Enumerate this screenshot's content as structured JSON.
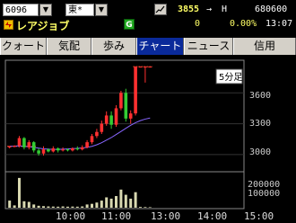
{
  "header": {
    "code": "6096",
    "market": "東*",
    "company": "レアジョブ",
    "price": "3855",
    "arrow": "→",
    "high_flag": "H",
    "volume": "680600",
    "change": "0",
    "change_pct": "0.00%",
    "time": "13:07",
    "g_badge": "G",
    "colors": {
      "price": "#ffff66",
      "change": "#ffff66",
      "time": "#ffffff",
      "badge": "#22aa22"
    }
  },
  "tabs": [
    {
      "label": "クォート"
    },
    {
      "label": "気配"
    },
    {
      "label": "歩み"
    },
    {
      "label": "チャート"
    },
    {
      "label": "ニュース"
    },
    {
      "label": "信用"
    }
  ],
  "chart": {
    "period_label": "5分足",
    "y_ticks": [
      "3600",
      "3300",
      "3000"
    ],
    "vol_ticks": [
      "200000",
      "100000"
    ],
    "x_ticks": [
      "10:00",
      "11:00",
      "13:00",
      "14:00",
      "15:00"
    ]
  },
  "chart_data": {
    "type": "candlestick",
    "interval": "5min",
    "ylim": [
      2850,
      3900
    ],
    "prev_close": 3080,
    "limit_high": 3855,
    "candles": [
      {
        "o": 3070,
        "h": 3085,
        "l": 3060,
        "c": 3080
      },
      {
        "o": 3080,
        "h": 3090,
        "l": 3070,
        "c": 3085
      },
      {
        "o": 3085,
        "h": 3180,
        "l": 3070,
        "c": 3160
      },
      {
        "o": 3160,
        "h": 3170,
        "l": 3050,
        "c": 3070
      },
      {
        "o": 3070,
        "h": 3140,
        "l": 3050,
        "c": 3120
      },
      {
        "o": 3120,
        "h": 3130,
        "l": 3020,
        "c": 3040
      },
      {
        "o": 3040,
        "h": 3060,
        "l": 2990,
        "c": 3010
      },
      {
        "o": 3010,
        "h": 3080,
        "l": 2990,
        "c": 3050
      },
      {
        "o": 3050,
        "h": 3060,
        "l": 3020,
        "c": 3030
      },
      {
        "o": 3030,
        "h": 3080,
        "l": 3020,
        "c": 3060
      },
      {
        "o": 3060,
        "h": 3070,
        "l": 3020,
        "c": 3040
      },
      {
        "o": 3040,
        "h": 3070,
        "l": 3030,
        "c": 3050
      },
      {
        "o": 3050,
        "h": 3060,
        "l": 3030,
        "c": 3040
      },
      {
        "o": 3040,
        "h": 3070,
        "l": 3030,
        "c": 3060
      },
      {
        "o": 3060,
        "h": 3080,
        "l": 3040,
        "c": 3050
      },
      {
        "o": 3050,
        "h": 3090,
        "l": 3040,
        "c": 3070
      },
      {
        "o": 3070,
        "h": 3140,
        "l": 3060,
        "c": 3120
      },
      {
        "o": 3120,
        "h": 3200,
        "l": 3100,
        "c": 3180
      },
      {
        "o": 3180,
        "h": 3250,
        "l": 3160,
        "c": 3220
      },
      {
        "o": 3220,
        "h": 3330,
        "l": 3200,
        "c": 3300
      },
      {
        "o": 3300,
        "h": 3420,
        "l": 3280,
        "c": 3380
      },
      {
        "o": 3380,
        "h": 3420,
        "l": 3250,
        "c": 3290
      },
      {
        "o": 3290,
        "h": 3480,
        "l": 3270,
        "c": 3450
      },
      {
        "o": 3450,
        "h": 3620,
        "l": 3430,
        "c": 3600
      },
      {
        "o": 3600,
        "h": 3640,
        "l": 3320,
        "c": 3350
      },
      {
        "o": 3350,
        "h": 3430,
        "l": 3300,
        "c": 3400
      },
      {
        "o": 3400,
        "h": 3855,
        "l": 3380,
        "c": 3855
      },
      {
        "o": 3855,
        "h": 3855,
        "l": 3855,
        "c": 3855
      },
      {
        "o": 3855,
        "h": 3855,
        "l": 3700,
        "c": 3855
      },
      {
        "o": 3855,
        "h": 3855,
        "l": 3855,
        "c": 3855
      }
    ],
    "ma": [
      3080,
      3082,
      3085,
      3080,
      3075,
      3070,
      3062,
      3056,
      3052,
      3050,
      3050,
      3052,
      3055,
      3058,
      3060,
      3064,
      3070,
      3080,
      3095,
      3115,
      3140,
      3165,
      3195,
      3225,
      3255,
      3285,
      3310,
      3330,
      3345,
      3355
    ],
    "volume": [
      55000,
      18000,
      230000,
      50000,
      45000,
      25000,
      15000,
      12000,
      10000,
      9000,
      8000,
      10000,
      8000,
      9000,
      8000,
      10000,
      25000,
      30000,
      40000,
      55000,
      80000,
      70000,
      90000,
      140000,
      100000,
      70000,
      120000,
      6000,
      5000,
      4000
    ]
  }
}
